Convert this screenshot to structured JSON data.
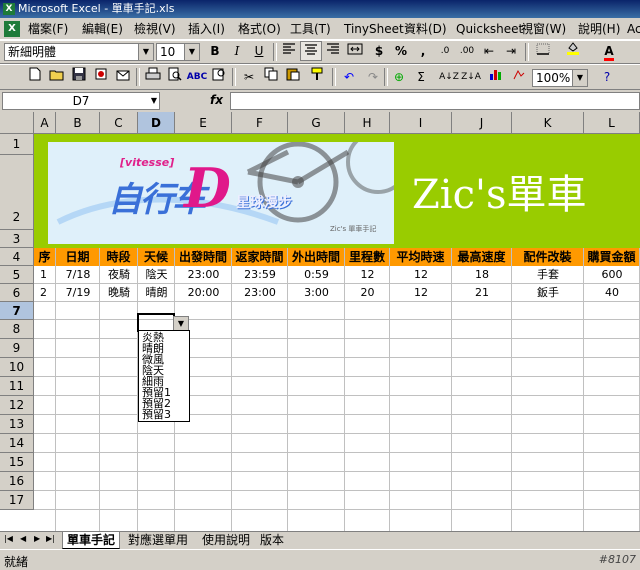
{
  "window": {
    "title": "Microsoft Excel - 單車手記.xls"
  },
  "menu": [
    "檔案(F)",
    "編輯(E)",
    "檢視(V)",
    "插入(I)",
    "格式(O)",
    "工具(T)",
    "TinySheet",
    "資料(D)",
    "Quicksheet",
    "視窗(W)",
    "說明(H)",
    "Ac"
  ],
  "format_toolbar": {
    "font_name": "新細明體",
    "font_size": "10",
    "bold": "B",
    "italic": "I",
    "underline": "U",
    "currency": "$",
    "percent": "%",
    "comma": ",",
    "inc_decimal": ".0",
    "dec_decimal": ".00"
  },
  "standard_toolbar": {
    "zoom": "100%",
    "sum": "Σ"
  },
  "formula_bar": {
    "name_box": "D7",
    "fx": "fx",
    "content": ""
  },
  "columns": [
    "A",
    "B",
    "C",
    "D",
    "E",
    "F",
    "G",
    "H",
    "I",
    "J",
    "K",
    "L"
  ],
  "rows": [
    "1",
    "2",
    "3",
    "4",
    "5",
    "6",
    "7",
    "8",
    "9",
    "10",
    "11",
    "12",
    "13",
    "14",
    "15",
    "16",
    "17"
  ],
  "banner": {
    "title": "Zic's單車",
    "logo_tag": "[vitesse]",
    "logo_main": "自行车",
    "logo_d": "D",
    "logo_sub": "星球漫步",
    "logo_credit": "Zic's 單車手記"
  },
  "table": {
    "headers": [
      "序",
      "日期",
      "時段",
      "天候",
      "出發時間",
      "返家時間",
      "外出時間",
      "里程數",
      "平均時速",
      "最高速度",
      "配件改裝",
      "購買金額"
    ],
    "rows": [
      [
        "1",
        "7/18",
        "夜騎",
        "陰天",
        "23:00",
        "23:59",
        "0:59",
        "12",
        "12",
        "18",
        "手套",
        "600"
      ],
      [
        "2",
        "7/19",
        "晚騎",
        "晴朗",
        "20:00",
        "23:00",
        "3:00",
        "20",
        "12",
        "21",
        "鈑手",
        "40"
      ]
    ]
  },
  "dropdown": {
    "options": [
      "炎熱",
      "晴朗",
      "微風",
      "陰天",
      "細雨",
      "預留1",
      "預留2",
      "預留3"
    ]
  },
  "sheet_tabs": [
    "單車手記",
    "對應選單用",
    "使用說明",
    "版本"
  ],
  "status": {
    "text": "就緒",
    "watermark": "#8107"
  },
  "colors": {
    "banner": "#99cc00",
    "header_fill": "#ff9900",
    "title_bar": "#0a246a"
  }
}
